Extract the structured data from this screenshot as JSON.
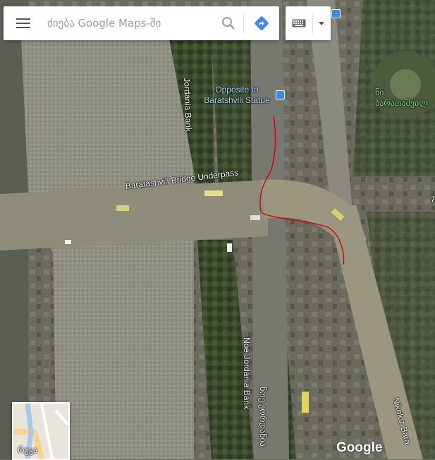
{
  "search": {
    "placeholder": "ძიება Google Maps-ში"
  },
  "icons": {
    "menu": "hamburger-menu-icon",
    "search": "search-icon",
    "directions": "directions-icon",
    "keyboard": "keyboard-icon",
    "dropdown": "dropdown-arrow-icon",
    "bus_stop": "bus-stop-icon"
  },
  "labels": {
    "road_top": "Jordania Bank",
    "underpass": "Baratashvili Bridge Underpass",
    "noe_jordania": "Noe Jordania Bank",
    "noe_jordania_ka": "ნოე ჟორდანია",
    "nikoloz": "Nikoloz Bara",
    "poi_opposite": "Opposite to\nBaratshvili Statue",
    "poi_park": "ნი\nბარათაშვილ",
    "edge_char": "7"
  },
  "minimap": {
    "label": "რუკა"
  },
  "brand": {
    "logo": "Google"
  },
  "colors": {
    "accent": "#4285f4",
    "route_line": "#e00000",
    "poi_blue": "#a7e0ff",
    "poi_green": "#86d58b"
  }
}
